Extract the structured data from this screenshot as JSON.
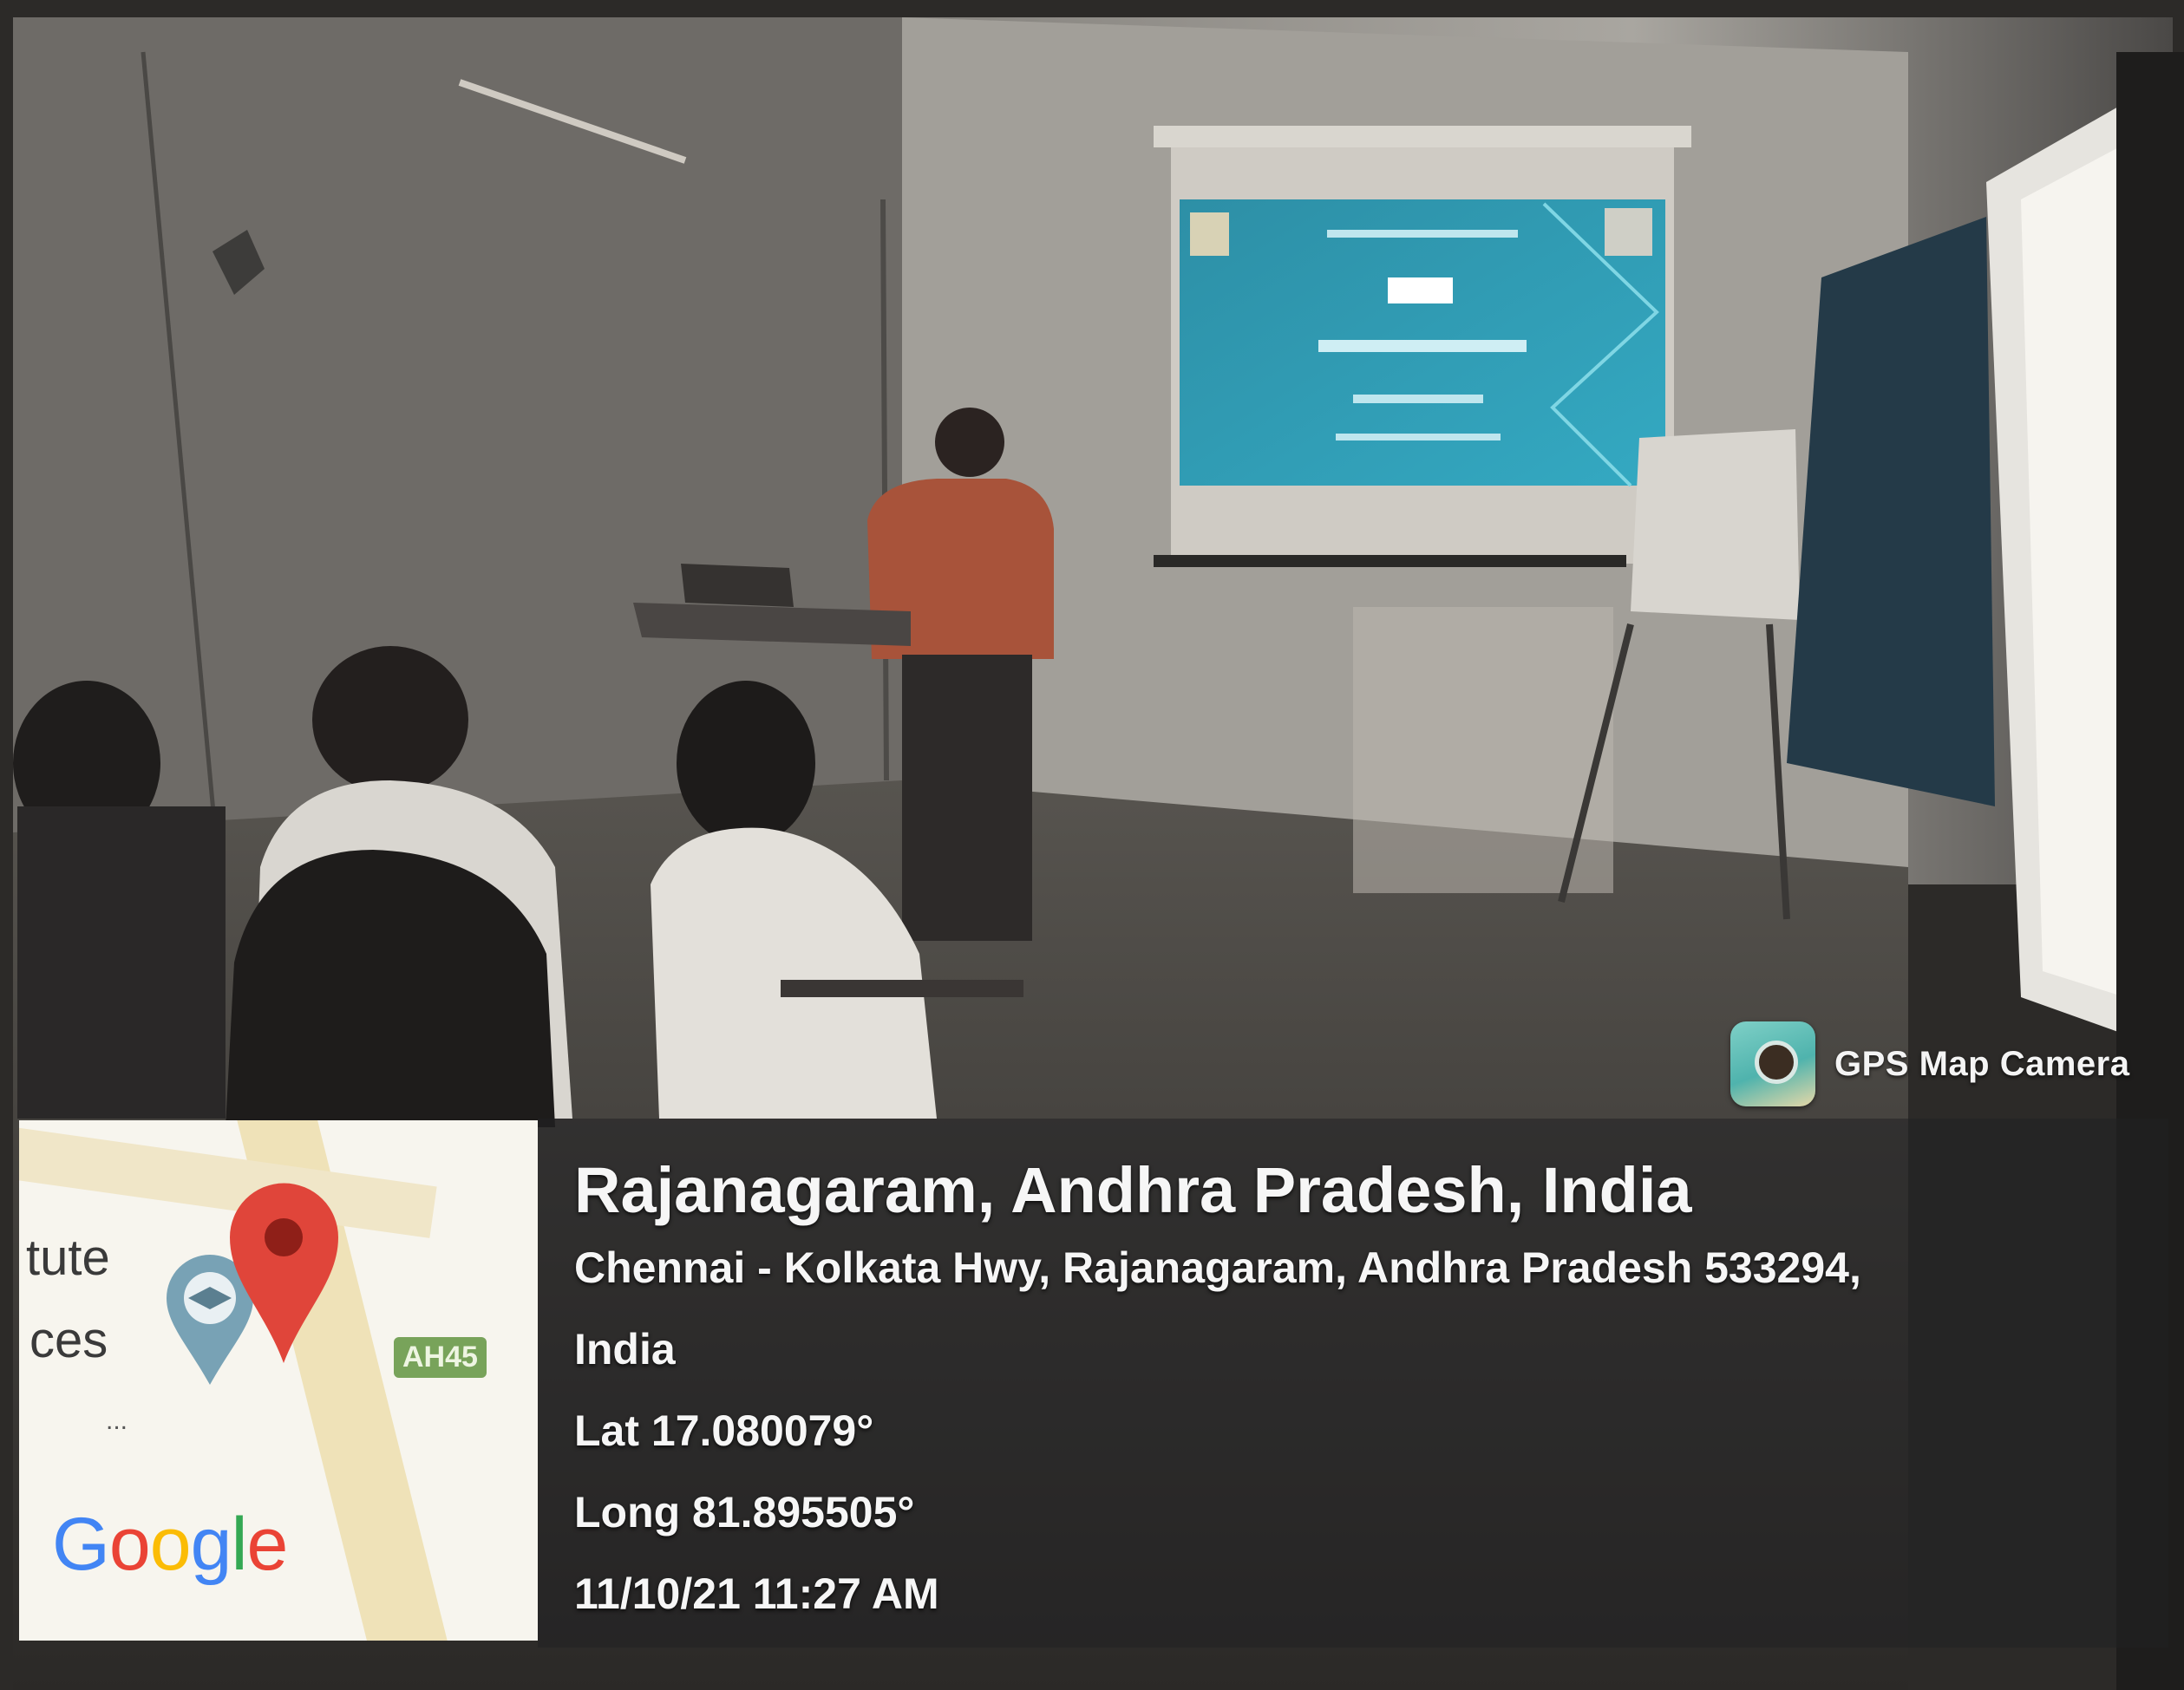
{
  "app": {
    "watermark": "GPS Map Camera"
  },
  "location": {
    "title": "Rajanagaram, Andhra Pradesh, India",
    "address_line1": "Chennai - Kolkata Hwy, Rajanagaram, Andhra Pradesh 533294,",
    "address_line2": "India",
    "latitude": "Lat 17.080079°",
    "longitude": "Long 81.895505°",
    "datetime": "11/10/21 11:27 AM"
  },
  "map": {
    "label_1": "tute",
    "label_2": "ces",
    "road_badge": "AH45",
    "dots": "...",
    "brand": "Google",
    "pin_icon": "map-pin-icon",
    "school_icon": "school-pin-icon"
  },
  "colors": {
    "pin_red": "#e0453a",
    "overlay": "#202022",
    "slide_blue": "#2aa0b8"
  }
}
